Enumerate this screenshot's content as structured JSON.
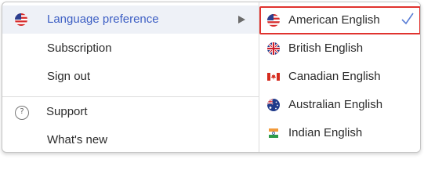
{
  "main_menu": {
    "items": [
      {
        "label": "Language preference",
        "icon": "us-flag-icon",
        "active": true,
        "has_submenu": true
      },
      {
        "label": "Subscription"
      },
      {
        "label": "Sign out"
      },
      {
        "label": "Support",
        "icon": "help-circle-icon"
      },
      {
        "label": "What's new"
      }
    ],
    "help_glyph": "?"
  },
  "language_submenu": {
    "items": [
      {
        "label": "American English",
        "flag": "us-flag-icon",
        "selected": true
      },
      {
        "label": "British English",
        "flag": "uk-flag-icon"
      },
      {
        "label": "Canadian English",
        "flag": "canada-flag-icon"
      },
      {
        "label": "Australian English",
        "flag": "australia-flag-icon"
      },
      {
        "label": "Indian English",
        "flag": "india-flag-icon"
      }
    ]
  },
  "colors": {
    "active_text": "#3d5fc4",
    "active_background": "#eef1f7",
    "highlight_border": "#e0332f",
    "check": "#5a7ed6"
  }
}
